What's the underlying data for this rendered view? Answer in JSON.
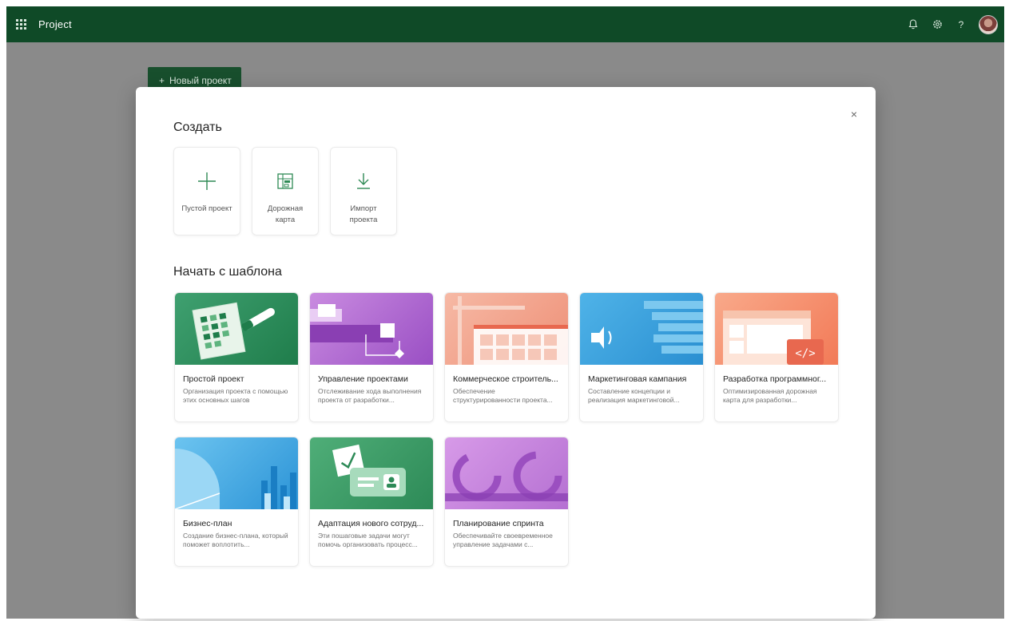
{
  "topbar": {
    "app_name": "Project",
    "icons": [
      "waffle-icon",
      "bell-icon",
      "gear-icon",
      "help-icon",
      "avatar"
    ],
    "help_glyph": "?"
  },
  "background": {
    "new_project_label": "Новый проект"
  },
  "modal": {
    "close_glyph": "×",
    "create_title": "Создать",
    "create_items": [
      {
        "label": "Пустой проект",
        "icon": "plus-icon"
      },
      {
        "label": "Дорожная карта",
        "icon": "roadmap-icon"
      },
      {
        "label": "Импорт проекта",
        "icon": "import-icon"
      }
    ],
    "templates_title": "Начать с шаблона",
    "templates": [
      {
        "title": "Простой проект",
        "desc": "Организация проекта с помощью этих основных шагов"
      },
      {
        "title": "Управление проектами",
        "desc": "Отслеживание хода выполнения проекта от разработки..."
      },
      {
        "title": "Коммерческое строитель...",
        "desc": "Обеспечение структурированности проекта..."
      },
      {
        "title": "Маркетинговая кампания",
        "desc": "Составление концепции и реализация маркетинговой..."
      },
      {
        "title": "Разработка программног...",
        "desc": "Оптимизированная дорожная карта для разработки..."
      },
      {
        "title": "Бизнес-план",
        "desc": "Создание бизнес-плана, который поможет воплотить..."
      },
      {
        "title": "Адаптация нового сотруд...",
        "desc": "Эти пошаговые задачи могут помочь организовать процесс..."
      },
      {
        "title": "Планирование спринта",
        "desc": "Обеспечивайте своевременное управление задачами с..."
      }
    ]
  },
  "colors": {
    "topbar": "#0f4a27",
    "accent_green": "#2e8a55",
    "backdrop": "#8a8a8a"
  }
}
